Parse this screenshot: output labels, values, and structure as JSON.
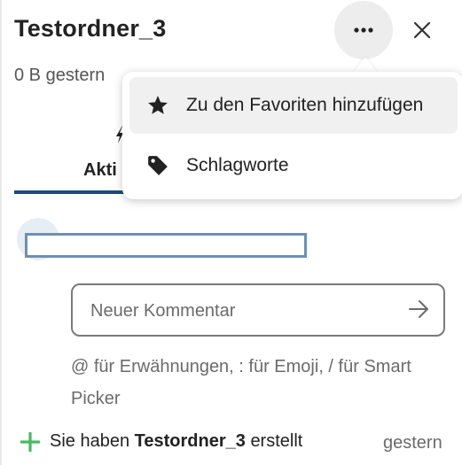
{
  "header": {
    "title": "Testordner_3",
    "subtitle": "0 B gestern",
    "more_icon": "more-horizontal-icon",
    "close_icon": "close-icon"
  },
  "tabs": [
    {
      "label": "Akti"
    }
  ],
  "comment": {
    "placeholder": "Neuer Kommentar",
    "hint": "@ für Erwähnungen, : für Emoji, / für Smart Picker"
  },
  "activity": {
    "prefix": "Sie haben",
    "object": "Testordner_3",
    "suffix": "erstellt",
    "time": "gestern",
    "icon": "plus-icon",
    "icon_color": "#46ba61"
  },
  "menu": {
    "items": [
      {
        "label": "Zu den Favoriten hinzufügen",
        "icon": "star-icon"
      },
      {
        "label": "Schlagworte",
        "icon": "tag-icon"
      }
    ]
  },
  "colors": {
    "accent": "#1e4a7e",
    "more_button_bg": "#ededed"
  }
}
